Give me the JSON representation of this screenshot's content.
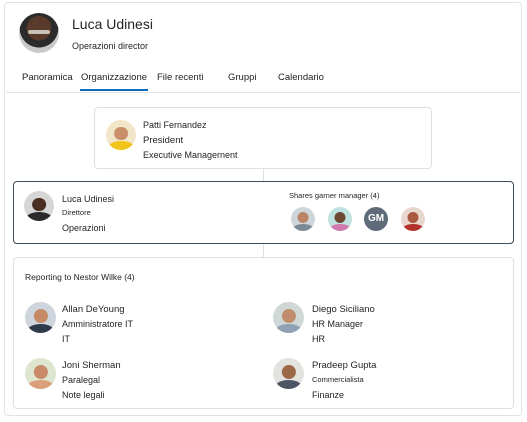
{
  "profile": {
    "name": "Luca Udinesi",
    "title": "Operazioni director"
  },
  "tabs": [
    {
      "label": "Panoramica"
    },
    {
      "label": "Organizzazione",
      "active": true
    },
    {
      "label": "File recenti"
    },
    {
      "label": "Gruppi"
    },
    {
      "label": "Calendario"
    }
  ],
  "manager": {
    "name": "Patti Fernandez",
    "title": "President",
    "department": "Executive Managernent"
  },
  "current": {
    "name": "Luca Udinesi",
    "title": "Direttore",
    "department": "Operazioni",
    "peers_label": "Shares garner manager (4)",
    "peers": [
      {
        "initials": ""
      },
      {
        "initials": ""
      },
      {
        "initials": "GM"
      },
      {
        "initials": ""
      }
    ]
  },
  "reports": {
    "header": "Reporting to Nestor Wilke (4)",
    "people": [
      {
        "name": "Allan DeYoung",
        "title": "Amministratore IT",
        "department": "IT"
      },
      {
        "name": "Diego Siciliano",
        "title": "HR Manager",
        "department": "HR"
      },
      {
        "name": "Joni Sherman",
        "title": "Paralegal",
        "department": "Note legali"
      },
      {
        "name": "Pradeep Gupta",
        "title": "Commercialista",
        "department": "Finanze"
      }
    ]
  },
  "colors": {
    "accent": "#0f6cbd",
    "selected_border": "#3b4a5c",
    "initials_avatar": "#5f6b7a"
  }
}
